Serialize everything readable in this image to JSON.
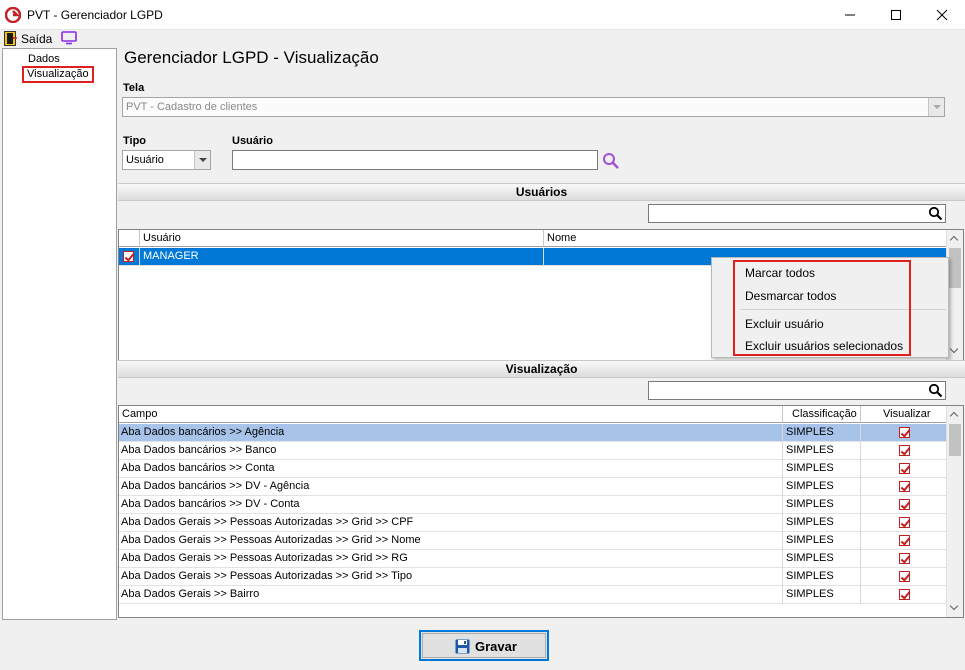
{
  "window": {
    "title": "PVT - Gerenciador LGPD"
  },
  "menu": {
    "exit_label": "Saída"
  },
  "sidebar": {
    "items": [
      {
        "label": "Dados"
      },
      {
        "label": "Visualização"
      }
    ]
  },
  "main": {
    "page_title": "Gerenciador LGPD - Visualização",
    "tela_label": "Tela",
    "tela_value": "PVT - Cadastro de clientes",
    "tipo_label": "Tipo",
    "tipo_value": "Usuário",
    "usuario_label": "Usuário",
    "usuario_value": ""
  },
  "usuarios_section": {
    "title": "Usuários",
    "columns": [
      "Usuário",
      "Nome"
    ],
    "rows": [
      {
        "usuario": "MANAGER",
        "nome": "",
        "checked": true
      }
    ]
  },
  "context_menu": {
    "items": [
      "Marcar todos",
      "Desmarcar todos",
      "Excluir usuário",
      "Excluir usuários selecionados"
    ]
  },
  "visualizacao_section": {
    "title": "Visualização",
    "columns": [
      "Campo",
      "Classificação",
      "Visualizar"
    ],
    "rows": [
      {
        "campo": "Aba Dados bancários >> Agência",
        "classificacao": "SIMPLES",
        "visualizar": true
      },
      {
        "campo": "Aba Dados bancários >> Banco",
        "classificacao": "SIMPLES",
        "visualizar": true
      },
      {
        "campo": "Aba Dados bancários >> Conta",
        "classificacao": "SIMPLES",
        "visualizar": true
      },
      {
        "campo": "Aba Dados bancários >> DV - Agência",
        "classificacao": "SIMPLES",
        "visualizar": true
      },
      {
        "campo": "Aba Dados bancários >> DV - Conta",
        "classificacao": "SIMPLES",
        "visualizar": true
      },
      {
        "campo": "Aba Dados Gerais >>  Pessoas Autorizadas >> Grid >> CPF",
        "classificacao": "SIMPLES",
        "visualizar": true
      },
      {
        "campo": "Aba Dados Gerais >>  Pessoas Autorizadas >> Grid >> Nome",
        "classificacao": "SIMPLES",
        "visualizar": true
      },
      {
        "campo": "Aba Dados Gerais >>  Pessoas Autorizadas >> Grid >> RG",
        "classificacao": "SIMPLES",
        "visualizar": true
      },
      {
        "campo": "Aba Dados Gerais >>  Pessoas Autorizadas >> Grid >> Tipo",
        "classificacao": "SIMPLES",
        "visualizar": true
      },
      {
        "campo": "Aba Dados Gerais >> Bairro",
        "classificacao": "SIMPLES",
        "visualizar": true
      }
    ]
  },
  "footer": {
    "save_label": "Gravar"
  },
  "colors": {
    "accent_red": "#e0201c",
    "selection_blue": "#0078d7",
    "selection_light": "#a7c3ea",
    "check_red": "#c02020"
  }
}
